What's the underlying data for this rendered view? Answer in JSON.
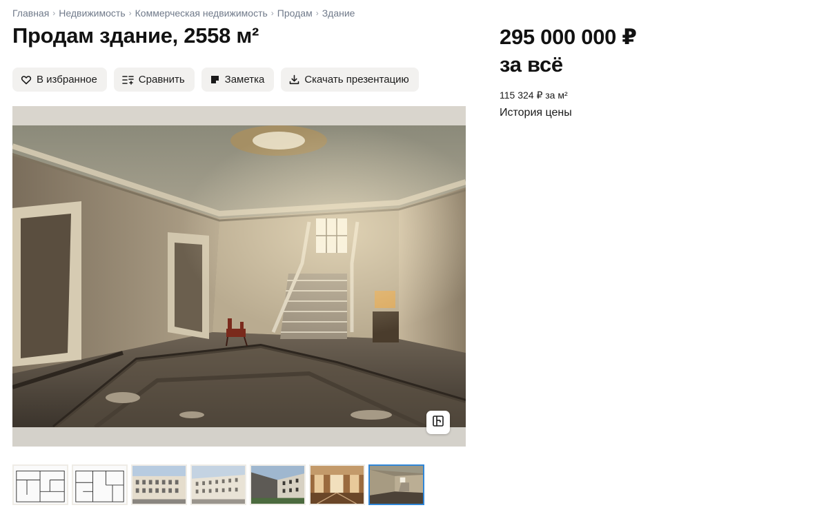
{
  "breadcrumb": [
    {
      "label": "Главная"
    },
    {
      "label": "Недвижимость"
    },
    {
      "label": "Коммерческая недвижимость"
    },
    {
      "label": "Продам"
    },
    {
      "label": "Здание"
    }
  ],
  "breadcrumb_separator": "›",
  "listing": {
    "title": "Продам здание, 2558 м²",
    "price": "295 000 000 ₽",
    "price_note": "за всё",
    "price_per_m2": "115 324 ₽ за м²",
    "price_history_link": "История цены"
  },
  "actions": {
    "favorite": "В избранное",
    "compare": "Сравнить",
    "note": "Заметка",
    "download": "Скачать презентацию"
  },
  "gallery": {
    "icon": "floor-plan-icon",
    "thumbnails": [
      {
        "kind": "floor-plan"
      },
      {
        "kind": "floor-plan"
      },
      {
        "kind": "facade"
      },
      {
        "kind": "facade"
      },
      {
        "kind": "facade-angle"
      },
      {
        "kind": "interior-hall"
      },
      {
        "kind": "interior-staircase",
        "selected": true
      }
    ]
  },
  "colors": {
    "accent_selected_thumb": "#2f86d8",
    "button_bg": "#f2f1ef",
    "breadcrumb_text": "#707a8a"
  }
}
